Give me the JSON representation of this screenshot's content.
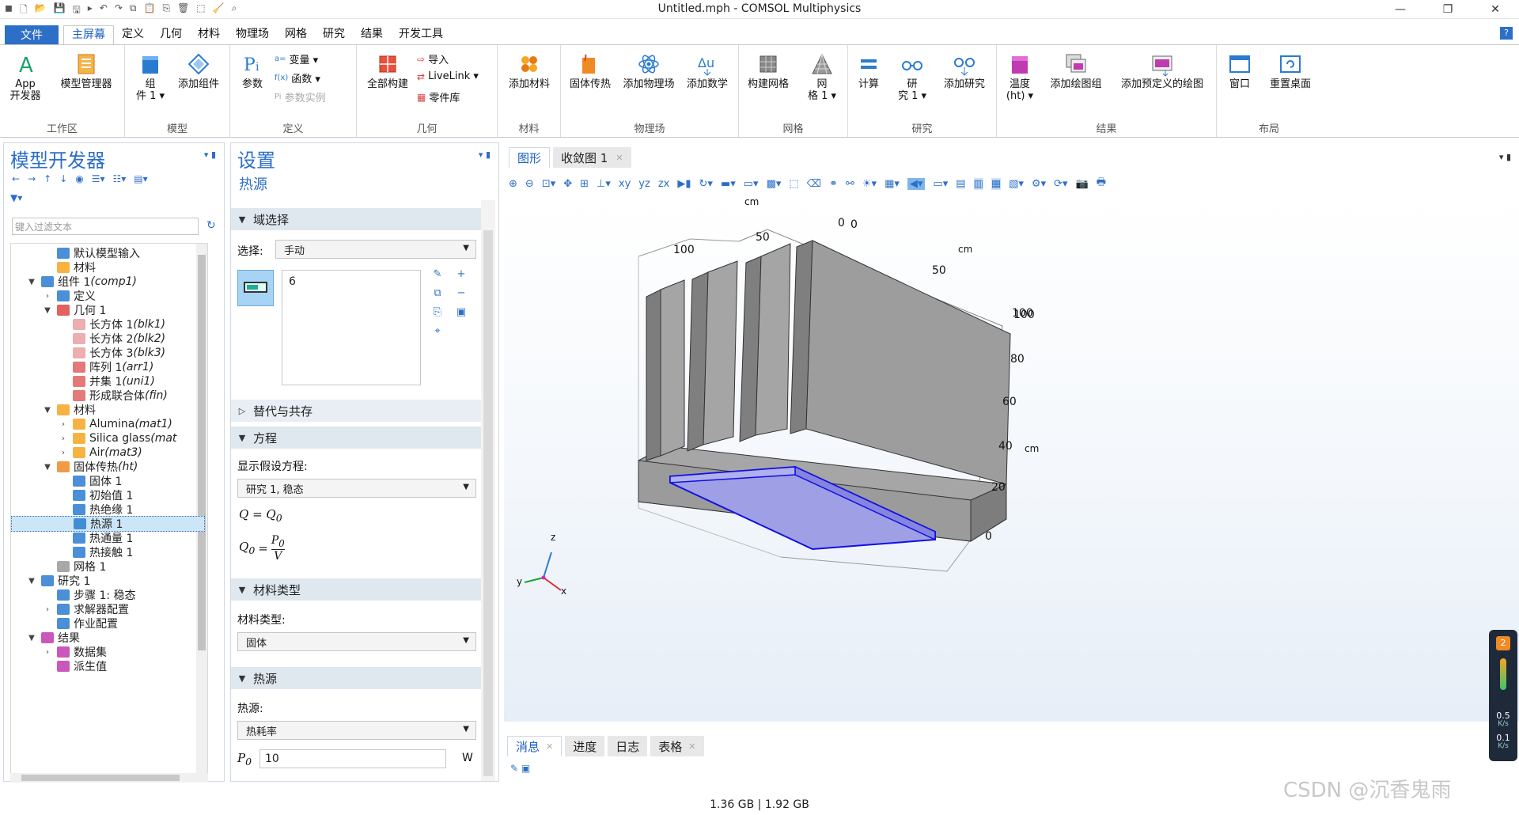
{
  "window": {
    "title": "Untitled.mph - COMSOL Multiphysics",
    "minimize": "—",
    "restore": "❐",
    "close": "✕"
  },
  "menu": {
    "file": "文件",
    "tabs": [
      "主屏幕",
      "定义",
      "几何",
      "材料",
      "物理场",
      "网格",
      "研究",
      "结果",
      "开发工具"
    ],
    "help": "?"
  },
  "ribbon": {
    "groups": [
      "工作区",
      "模型",
      "定义",
      "几何",
      "材料",
      "物理场",
      "网格",
      "研究",
      "结果",
      "布局"
    ],
    "app_dev_1": "App",
    "app_dev_2": "开发器",
    "model_manager": "模型管理器",
    "component_1": "组",
    "component_2": "件 1 ▾",
    "add_component": "添加组件",
    "parameters": "参数",
    "variables": "变量 ▾",
    "functions": "函数 ▾",
    "param_cases": "参数实例",
    "build_all": "全部构建",
    "import": "导入",
    "livelink": "LiveLink ▾",
    "parts": "零件库",
    "add_material": "添加材料",
    "solid_heat": "固体传热",
    "add_physics": "添加物理场",
    "add_math": "添加数学",
    "build_mesh": "构建网格",
    "mesh_1": "网",
    "mesh_2": "格 1 ▾",
    "compute": "计算",
    "study_1": "研",
    "study_2": "究 1 ▾",
    "add_study": "添加研究",
    "temperature_1": "温度",
    "temperature_2": "(ht) ▾",
    "add_plot_group": "添加绘图组",
    "add_predefined_plot": "添加预定义的绘图",
    "window_btn": "窗口",
    "reset_desktop": "重置桌面"
  },
  "model_builder": {
    "title": "模型开发器",
    "filter_placeholder": "键入过滤文本",
    "tree": [
      {
        "label": "默认模型输入",
        "italic": ""
      },
      {
        "label": "材料",
        "italic": ""
      },
      {
        "label": "组件 1 ",
        "italic": "(comp1)"
      },
      {
        "label": "定义",
        "italic": ""
      },
      {
        "label": "几何 1",
        "italic": ""
      },
      {
        "label": "长方体 1 ",
        "italic": "(blk1)"
      },
      {
        "label": "长方体 2 ",
        "italic": "(blk2)"
      },
      {
        "label": "长方体 3 ",
        "italic": "(blk3)"
      },
      {
        "label": "阵列 1 ",
        "italic": "(arr1)"
      },
      {
        "label": "并集 1 ",
        "italic": "(uni1)"
      },
      {
        "label": "形成联合体 ",
        "italic": "(fin)"
      },
      {
        "label": "材料",
        "italic": ""
      },
      {
        "label": "Alumina ",
        "italic": "(mat1)"
      },
      {
        "label": "Silica glass ",
        "italic": "(mat"
      },
      {
        "label": "Air ",
        "italic": "(mat3)"
      },
      {
        "label": "固体传热 ",
        "italic": "(ht)"
      },
      {
        "label": "固体 1",
        "italic": ""
      },
      {
        "label": "初始值 1",
        "italic": ""
      },
      {
        "label": "热绝缘 1",
        "italic": ""
      },
      {
        "label": "热源 1",
        "italic": ""
      },
      {
        "label": "热通量 1",
        "italic": ""
      },
      {
        "label": "热接触 1",
        "italic": ""
      },
      {
        "label": "网格 1",
        "italic": ""
      },
      {
        "label": "研究 1",
        "italic": ""
      },
      {
        "label": "步骤 1: 稳态",
        "italic": ""
      },
      {
        "label": "求解器配置",
        "italic": ""
      },
      {
        "label": "作业配置",
        "italic": ""
      },
      {
        "label": "结果",
        "italic": ""
      },
      {
        "label": "数据集",
        "italic": ""
      },
      {
        "label": "派生值",
        "italic": ""
      }
    ]
  },
  "settings": {
    "title": "设置",
    "subtitle": "热源",
    "domain_selection": "域选择",
    "selection_label": "选择:",
    "selection_value": "手动",
    "selection_item": "6",
    "override": "替代与共存",
    "equation": "方程",
    "show_eq_label": "显示假设方程:",
    "show_eq_value": "研究 1, 稳态",
    "eq1_lhs": "Q = Q",
    "eq1_sub": "0",
    "eq2_lhs": "Q",
    "eq2_sub": "0",
    "eq2_eq": "=",
    "eq2_num": "P",
    "eq2_num_sub": "0",
    "eq2_den": "V",
    "material_type": "材料类型",
    "material_type_label": "材料类型:",
    "material_type_value": "固体",
    "heat_source": "热源",
    "heat_source_label": "热源:",
    "heat_source_value": "热耗率",
    "p0_label": "P",
    "p0_sub": "0",
    "p0_value": "10",
    "p0_unit": "W"
  },
  "graphics": {
    "tabs": [
      "图形",
      "收敛图 1"
    ],
    "axis_unit": "cm",
    "xy_ticks": [
      "0",
      "50",
      "100"
    ],
    "y2_ticks": [
      "0",
      "50",
      "100"
    ],
    "z_ticks": [
      "0",
      "20",
      "40",
      "60",
      "80",
      "100"
    ],
    "triad": {
      "x": "x",
      "y": "y",
      "z": "z"
    }
  },
  "messages": {
    "tabs": [
      "消息",
      "进度",
      "日志",
      "表格"
    ]
  },
  "status": {
    "memory": "1.36 GB | 1.92 GB"
  },
  "side_widget": {
    "badge": "2",
    "rate1": "0.5",
    "rate1_unit": "K/s",
    "rate2": "0.1",
    "rate2_unit": "K/s"
  },
  "watermark": "CSDN @沉香鬼雨",
  "colors": {
    "accent": "#2d6fc7",
    "selection_fill": "#9f9fe6",
    "selection_edge": "#1010e0",
    "part": "#9a9a9a"
  }
}
